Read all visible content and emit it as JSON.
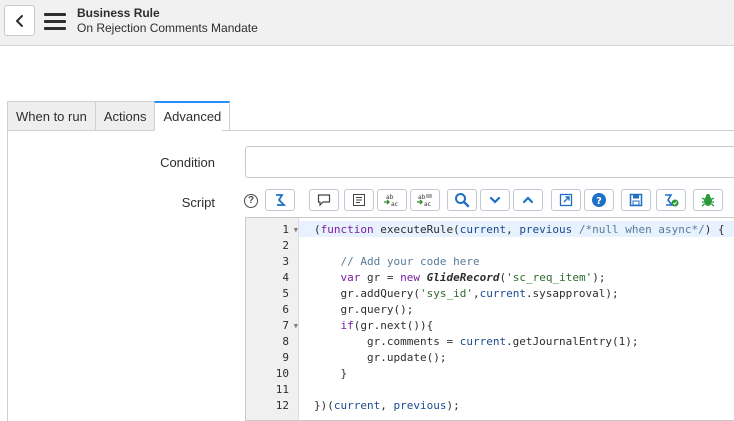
{
  "header": {
    "title": "Business Rule",
    "subtitle": "On Rejection Comments Mandate"
  },
  "tabs": [
    {
      "label": "When to run",
      "active": false
    },
    {
      "label": "Actions",
      "active": false
    },
    {
      "label": "Advanced",
      "active": true
    }
  ],
  "form": {
    "condition_label": "Condition",
    "condition_value": "",
    "script_label": "Script",
    "help_icon": "question-circle-icon"
  },
  "toolbar": {
    "icons": [
      "toggle-syntax-icon",
      "comment-icon",
      "format-code-icon",
      "replace-icon",
      "replace-all-icon",
      "search-icon",
      "collapse-icon",
      "expand-icon",
      "fullscreen-icon",
      "help-icon",
      "save-icon",
      "script-debugger-icon",
      "debug-icon"
    ]
  },
  "editor": {
    "line_numbers": [
      "1",
      "2",
      "3",
      "4",
      "5",
      "6",
      "7",
      "8",
      "9",
      "10",
      "11",
      "12"
    ],
    "lines": [
      "(function executeRule(current, previous /*null when async*/) {",
      "",
      "    // Add your code here",
      "    var gr = new GlideRecord('sc_req_item');",
      "    gr.addQuery('sys_id',current.sysapproval);",
      "    gr.query();",
      "    if(gr.next()){",
      "        gr.comments = current.getJournalEntry(1);",
      "        gr.update();",
      "    }",
      "",
      "})(current, previous);"
    ]
  },
  "colors": {
    "accent": "#278efc",
    "header_bg": "#f1f1f1",
    "toolbar_icon": "#1f6fc5"
  }
}
